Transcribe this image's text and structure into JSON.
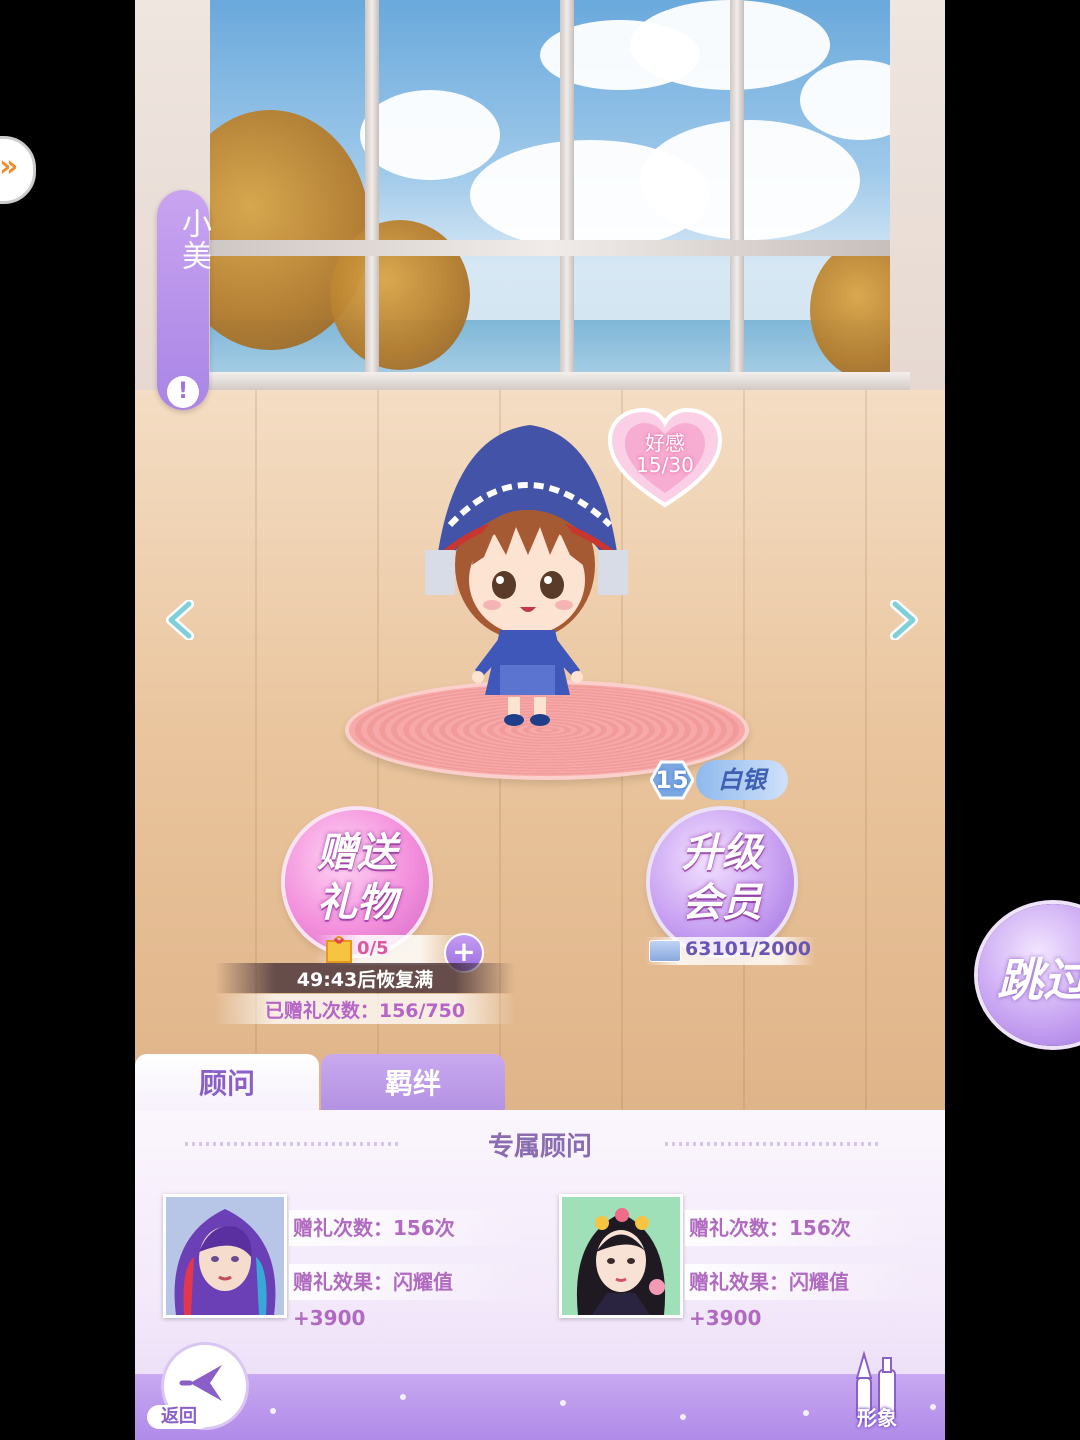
{
  "character": {
    "name": "小美",
    "alert": "!",
    "affection_label": "好感",
    "affection_value": "15/30",
    "rank_level": "15",
    "rank_name": "白银"
  },
  "actions": {
    "gift_button_label": "赠送礼物",
    "gift_count": "0/5",
    "gift_plus": "+",
    "recover_text": "49:43后恢复满",
    "gifted_count_text": "已赠礼次数：156/750",
    "vip_button_label": "升级会员",
    "vip_progress": "63101/2000",
    "skip_label": "跳过"
  },
  "tabs": [
    {
      "label": "顾问",
      "active": true
    },
    {
      "label": "羁绊",
      "active": false
    }
  ],
  "panel": {
    "section_title": "专属顾问",
    "advisors": [
      {
        "gift_count": "赠礼次数：156次",
        "gift_effect": "赠礼效果：闪耀值+3900"
      },
      {
        "gift_count": "赠礼次数：156次",
        "gift_effect": "赠礼效果：闪耀值+3900"
      }
    ]
  },
  "nav": {
    "back_label": "返回",
    "outfit_label": "形象"
  },
  "side_pull_icon": "»",
  "colors": {
    "accent_purple": "#a985e6",
    "gift_pink": "#f38fdc",
    "text_purple": "#b06bc0"
  }
}
